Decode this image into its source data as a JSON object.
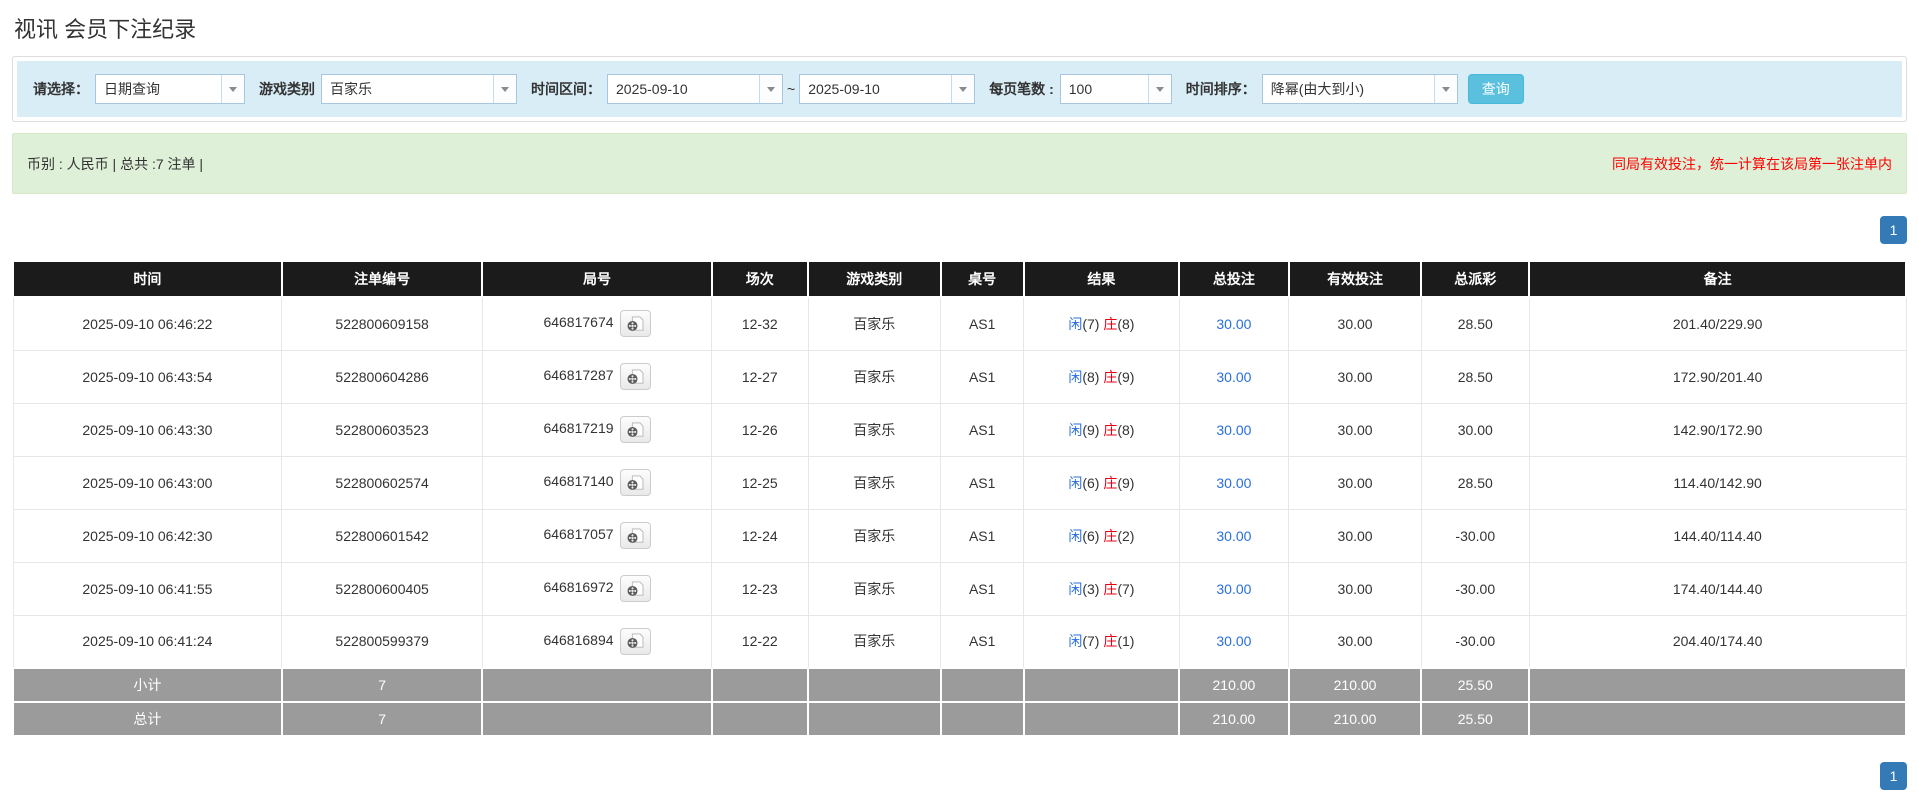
{
  "page": {
    "title": "视讯 会员下注纪录"
  },
  "filters": {
    "select_label": "请选择：",
    "select_value": "日期查询",
    "game_type_label": "游戏类别",
    "game_type_value": "百家乐",
    "time_range_label": "时间区间：",
    "date_from": "2025-09-10",
    "tilde": "~",
    "date_to": "2025-09-10",
    "page_size_label": "每页笔数 :",
    "page_size_value": "100",
    "sort_label": "时间排序：",
    "sort_value": "降幂(由大到小)",
    "search_button": "查询"
  },
  "summary": {
    "left_text": "币别 : 人民币 | 总共 :7 注单 |",
    "right_notice": "同局有效投注，统一计算在该局第一张注单内"
  },
  "pagination": {
    "page": "1"
  },
  "table": {
    "headers": [
      "时间",
      "注单编号",
      "局号",
      "场次",
      "游戏类别",
      "桌号",
      "结果",
      "总投注",
      "有效投注",
      "总派彩",
      "备注"
    ],
    "rows": [
      {
        "time": "2025-09-10 06:46:22",
        "bet_id": "522800609158",
        "round_id": "646817674",
        "session": "12-32",
        "game": "百家乐",
        "table_no": "AS1",
        "result": {
          "player_label": "闲",
          "player": "7",
          "banker_label": "庄",
          "banker": "8"
        },
        "total_bet": "30.00",
        "valid_bet": "30.00",
        "payout": "28.50",
        "remark": "201.40/229.90"
      },
      {
        "time": "2025-09-10 06:43:54",
        "bet_id": "522800604286",
        "round_id": "646817287",
        "session": "12-27",
        "game": "百家乐",
        "table_no": "AS1",
        "result": {
          "player_label": "闲",
          "player": "8",
          "banker_label": "庄",
          "banker": "9"
        },
        "total_bet": "30.00",
        "valid_bet": "30.00",
        "payout": "28.50",
        "remark": "172.90/201.40"
      },
      {
        "time": "2025-09-10 06:43:30",
        "bet_id": "522800603523",
        "round_id": "646817219",
        "session": "12-26",
        "game": "百家乐",
        "table_no": "AS1",
        "result": {
          "player_label": "闲",
          "player": "9",
          "banker_label": "庄",
          "banker": "8"
        },
        "total_bet": "30.00",
        "valid_bet": "30.00",
        "payout": "30.00",
        "remark": "142.90/172.90"
      },
      {
        "time": "2025-09-10 06:43:00",
        "bet_id": "522800602574",
        "round_id": "646817140",
        "session": "12-25",
        "game": "百家乐",
        "table_no": "AS1",
        "result": {
          "player_label": "闲",
          "player": "6",
          "banker_label": "庄",
          "banker": "9"
        },
        "total_bet": "30.00",
        "valid_bet": "30.00",
        "payout": "28.50",
        "remark": "114.40/142.90"
      },
      {
        "time": "2025-09-10 06:42:30",
        "bet_id": "522800601542",
        "round_id": "646817057",
        "session": "12-24",
        "game": "百家乐",
        "table_no": "AS1",
        "result": {
          "player_label": "闲",
          "player": "6",
          "banker_label": "庄",
          "banker": "2"
        },
        "total_bet": "30.00",
        "valid_bet": "30.00",
        "payout": "-30.00",
        "remark": "144.40/114.40"
      },
      {
        "time": "2025-09-10 06:41:55",
        "bet_id": "522800600405",
        "round_id": "646816972",
        "session": "12-23",
        "game": "百家乐",
        "table_no": "AS1",
        "result": {
          "player_label": "闲",
          "player": "3",
          "banker_label": "庄",
          "banker": "7"
        },
        "total_bet": "30.00",
        "valid_bet": "30.00",
        "payout": "-30.00",
        "remark": "174.40/144.40"
      },
      {
        "time": "2025-09-10 06:41:24",
        "bet_id": "522800599379",
        "round_id": "646816894",
        "session": "12-22",
        "game": "百家乐",
        "table_no": "AS1",
        "result": {
          "player_label": "闲",
          "player": "7",
          "banker_label": "庄",
          "banker": "1"
        },
        "total_bet": "30.00",
        "valid_bet": "30.00",
        "payout": "-30.00",
        "remark": "204.40/174.40"
      }
    ],
    "subtotal": {
      "label": "小计",
      "count": "7",
      "total_bet": "210.00",
      "valid_bet": "210.00",
      "payout": "25.50"
    },
    "total": {
      "label": "总计",
      "count": "7",
      "total_bet": "210.00",
      "valid_bet": "210.00",
      "payout": "25.50"
    }
  },
  "colors": {
    "filter_bg": "#d9edf7",
    "summary_bg": "#dff0d8",
    "search_button": "#5bc0de",
    "pagination_active": "#337ab7",
    "link_blue": "#2a6fdb",
    "player_blue": "#2a6fdb",
    "banker_red": "#e60012",
    "negative_red": "#ff0000",
    "notice_red": "#ff0000",
    "header_bg": "#1b1b1b",
    "footer_bg": "#9b9b9b"
  }
}
